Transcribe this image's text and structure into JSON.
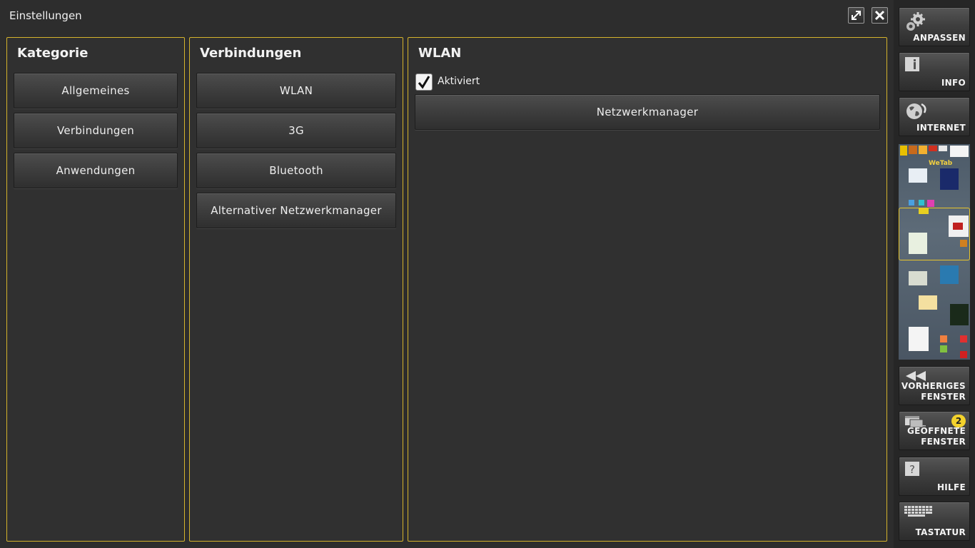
{
  "window": {
    "title": "Einstellungen"
  },
  "category_panel": {
    "heading": "Kategorie",
    "items": [
      "Allgemeines",
      "Verbindungen",
      "Anwendungen"
    ]
  },
  "connections_panel": {
    "heading": "Verbindungen",
    "items": [
      "WLAN",
      "3G",
      "Bluetooth",
      "Alternativer Netzwerkmanager"
    ]
  },
  "wlan_panel": {
    "heading": "WLAN",
    "enabled_label": "Aktiviert",
    "enabled": true,
    "network_manager_button": "Netzwerkmanager"
  },
  "sidebar": {
    "anpassen": "ANPASSEN",
    "info": "INFO",
    "internet": "INTERNET",
    "previous_line1": "VORHERIGES",
    "previous_line2": "FENSTER",
    "open_line1": "GEÖFFNETE",
    "open_line2": "FENSTER",
    "open_count": "2",
    "help": "HILFE",
    "keyboard": "TASTATUR",
    "preview_logo": "WeTab"
  },
  "colors": {
    "accent": "#d5b32c",
    "background": "#2d2d2d",
    "badge": "#f3d22c"
  }
}
